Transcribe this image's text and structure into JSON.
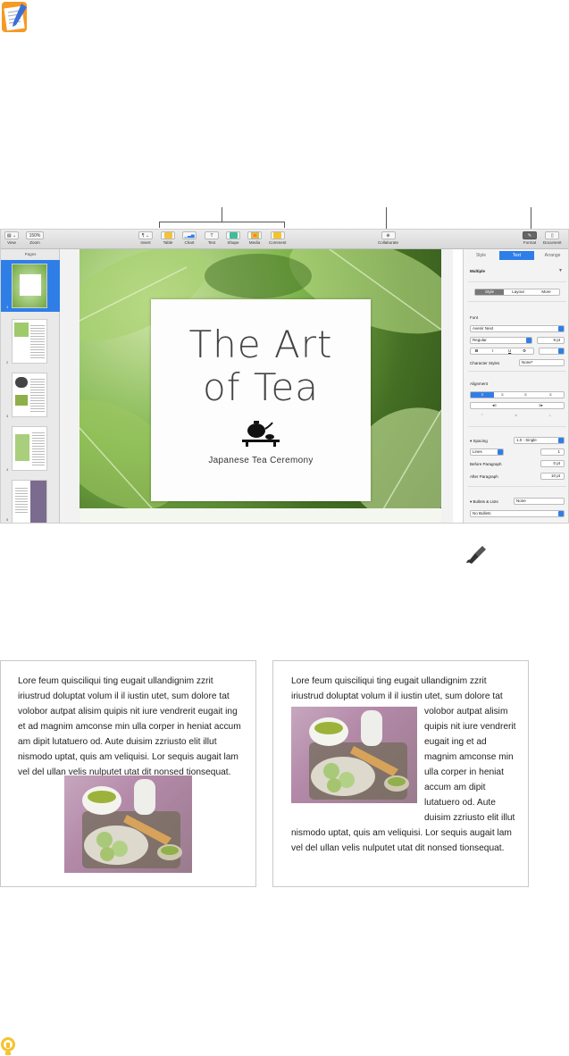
{
  "toolbar": {
    "view": "View",
    "zoom_value": "150%",
    "zoom": "Zoom",
    "insert": "Insert",
    "table": "Table",
    "chart": "Chart",
    "text": "Text",
    "shape": "Shape",
    "media": "Media",
    "comment": "Comment",
    "collaborate": "Collaborate",
    "format": "Format",
    "document": "Document"
  },
  "sidebar": {
    "title": "Pages",
    "thumbs": [
      "1",
      "2",
      "3",
      "4",
      "5"
    ]
  },
  "card": {
    "title_line1": "The Art",
    "title_line2": "of Tea",
    "subtitle": "Japanese Tea Ceremony"
  },
  "inspector": {
    "tabs": [
      "Style",
      "Text",
      "Arrange"
    ],
    "paragraph_style": "Multiple",
    "sub_tabs": [
      "Style",
      "Layout",
      "More"
    ],
    "font_label": "Font",
    "font_name": "Avenir Next",
    "font_weight": "Regular",
    "font_size": "9 pt",
    "format_buttons": [
      "B",
      "I",
      "U",
      "⚙"
    ],
    "char_styles_label": "Character Styles",
    "char_styles_value": "None*",
    "alignment_label": "Alignment",
    "spacing_label": "Spacing",
    "spacing_value": "1.0 - Single",
    "lines_value": "Lines",
    "lines_num": "1",
    "before_label": "Before Paragraph",
    "before_value": "0 pt",
    "after_label": "After Paragraph",
    "after_value": "10 pt",
    "bullets_label": "Bullets & Lists",
    "bullets_value": "None",
    "bullets_select": "No Bullets"
  },
  "examples": {
    "left_lines": [
      "Lore feum quisciliqui ting eugait ullandignim zzrit",
      "iriustrud doluptat volum il il iustin utet, sum dolore tat",
      "volobor autpat alisim quipis nit iure vendrerit eugait ing",
      "et ad magnim amconse min ulla corper in heniat accum",
      "am dipit lutatuero od. Aute duisim zzriusto elit illut",
      "nismodo uptat, quis am veliquisi. Lor sequis augait lam",
      "vel del ullan velis nulputet utat dit nonsed tionsequat."
    ],
    "right_top_lines": [
      "Lore feum quisciliqui ting eugait ullandignim zzrit",
      "iriustrud doluptat volum il il iustin utet, sum dolore tat"
    ],
    "right_wrap_lines": [
      "volobor autpat alisim",
      "quipis nit iure vendrerit",
      "eugait ing et ad",
      "magnim amconse min",
      "ulla corper in heniat",
      "accum am dipit",
      "lutatuero od. Aute",
      "duisim zzriusto elit illut"
    ],
    "right_bottom_lines": [
      "nismodo uptat, quis am veliquisi. Lor sequis augait lam",
      "vel del ullan velis nulputet utat dit nonsed tionsequat."
    ]
  },
  "colors": {
    "accent": "#2f7ee8",
    "comment_yellow": "#f5c32c"
  }
}
